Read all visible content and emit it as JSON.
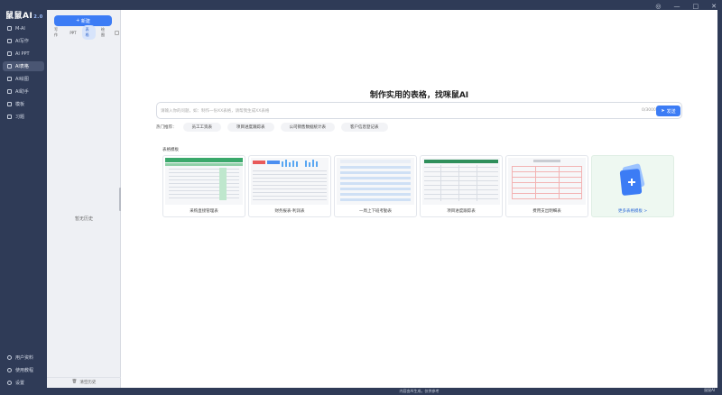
{
  "app": {
    "logo": "鼠鼠AI",
    "version": "2.0"
  },
  "window_controls": [
    "bell-icon",
    "minimize-icon",
    "maximize-icon",
    "close-icon"
  ],
  "nav": {
    "items": [
      {
        "label": "M-AI",
        "icon": "chat-icon",
        "active": false
      },
      {
        "label": "AI写作",
        "icon": "pen-icon",
        "active": false
      },
      {
        "label": "AI PPT",
        "icon": "slides-icon",
        "active": false
      },
      {
        "label": "AI表格",
        "icon": "table-icon",
        "active": true
      },
      {
        "label": "AI绘图",
        "icon": "image-icon",
        "active": false
      },
      {
        "label": "AI助手",
        "icon": "bot-icon",
        "active": false
      },
      {
        "label": "模板",
        "icon": "template-icon",
        "active": false
      },
      {
        "label": "习题",
        "icon": "book-icon",
        "active": false
      }
    ],
    "bottom": [
      {
        "label": "用户资料",
        "icon": "user-icon"
      },
      {
        "label": "使用教程",
        "icon": "help-icon"
      },
      {
        "label": "设置",
        "icon": "gear-icon"
      }
    ]
  },
  "history": {
    "new_label": "新建",
    "tabs": [
      "写作",
      "PPT",
      "表格",
      "绘图"
    ],
    "active_tab": 2,
    "empty_text": "暂无历史",
    "clear_label": "清空历史"
  },
  "main": {
    "title": "制作实用的表格，找咪鼠AI",
    "search_placeholder": "请输入你的问题，如：制作一份XX表格，请帮我生成XX表格",
    "counter": "0/3000",
    "send_label": "发送",
    "hot_label": "热门推荐：",
    "hot_chips": [
      "员工工资表",
      "项目进度跟踪表",
      "公司销售数据统计表",
      "客户信息登记表"
    ],
    "section_label": "表格模板",
    "templates": [
      {
        "label": "采购直接管理表"
      },
      {
        "label": "财务报表-利润表"
      },
      {
        "label": "一周上下班考勤表"
      },
      {
        "label": "项目进度跟踪表"
      },
      {
        "label": "费用支出明细表"
      },
      {
        "label": "更多表格模板 >"
      }
    ]
  },
  "footer": "内容由AI生成，仅供参考",
  "watermark": "鼠鼠AI"
}
